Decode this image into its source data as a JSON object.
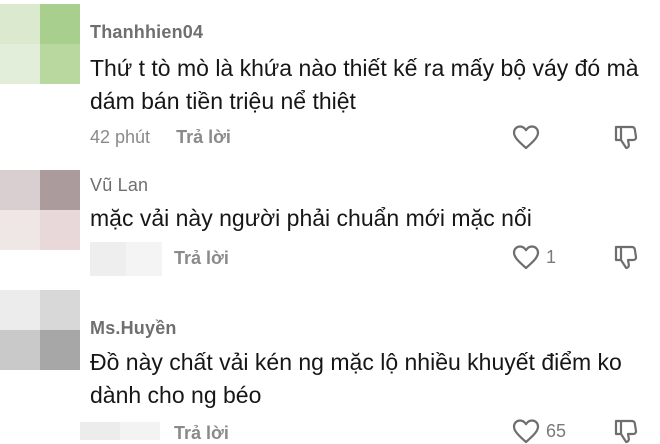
{
  "comments": [
    {
      "username": "Thanhhien04",
      "text": "Thứ t tò mò là khứa nào thiết kế ra mấy bộ váy đó mà dám bán tiền triệu nể thiệt",
      "time": "42 phút",
      "reply_label": "Trả lời",
      "likes": "",
      "avatar_colors": [
        "#dbe9cf",
        "#a9cf8e",
        "#e2eed9",
        "#b8d8a0"
      ]
    },
    {
      "username": "Vũ Lan",
      "text": "mặc vải này người phải chuẩn mới mặc nổi",
      "time": "",
      "reply_label": "Trả lời",
      "likes": "1",
      "avatar_colors": [
        "#d9cfd0",
        "#ab9b9c",
        "#efe6e6",
        "#e8d8da"
      ]
    },
    {
      "username": "Ms.Huyền",
      "text": "Đồ này chất vải kén ng mặc lộ nhiều khuyết điểm ko dành cho ng béo",
      "time": "",
      "reply_label": "Trả lời",
      "likes": "65",
      "avatar_colors": [
        "#ececec",
        "#d8d8d8",
        "#c9c9c9",
        "#a7a7a7"
      ]
    }
  ]
}
